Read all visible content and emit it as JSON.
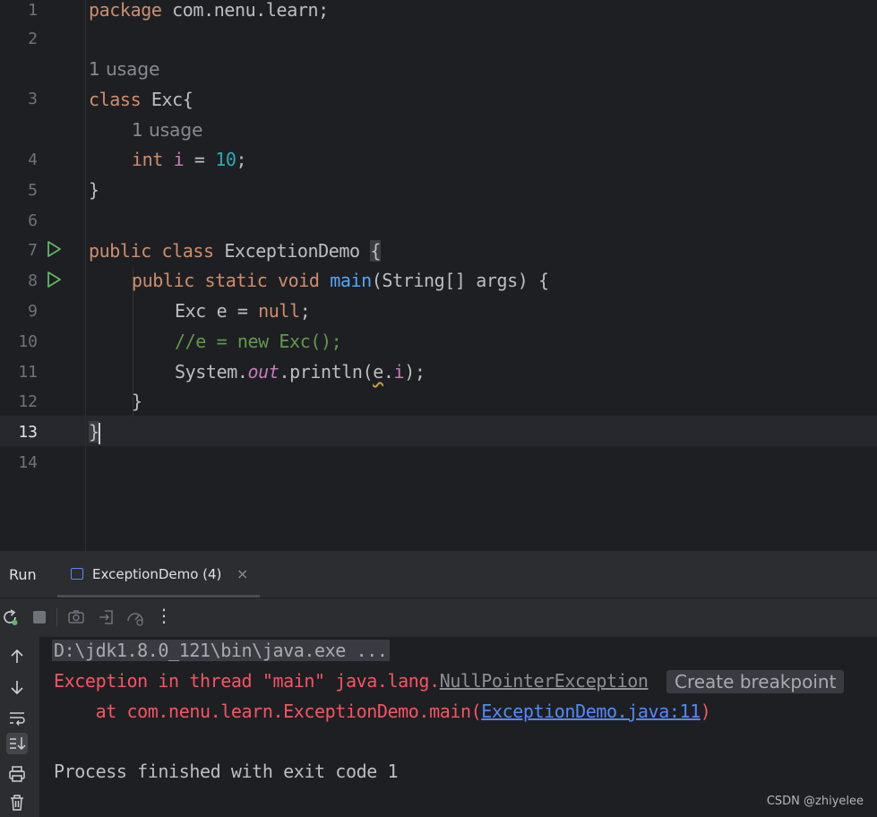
{
  "editor": {
    "line_numbers": [
      "1",
      "2",
      "3",
      "4",
      "5",
      "6",
      "7",
      "8",
      "9",
      "10",
      "11",
      "12",
      "13",
      "14"
    ],
    "current_line": "13",
    "hints": {
      "class_usage": "1 usage",
      "field_usage": "1 usage"
    },
    "code": {
      "l1_kw": "package",
      "l1_rest": " com.nenu.learn;",
      "l3_kw": "class",
      "l3_rest": " Exc{",
      "l4_kw": "int",
      "l4_field": "i",
      "l4_eq": " = ",
      "l4_num": "10",
      "l4_semi": ";",
      "l5": "}",
      "l7_kw": "public class",
      "l7_name": " ExceptionDemo ",
      "l7_brace": "{",
      "l8_kw": "public static void",
      "l8_fn": "main",
      "l8_rest": "(String[] args) {",
      "l9_text": "Exc e = ",
      "l9_kw": "null",
      "l9_semi": ";",
      "l10_comment": "//e = new Exc();",
      "l11_pre": "System.",
      "l11_out": "out",
      "l11_mid": ".println(",
      "l11_e": "e",
      "l11_dot": ".",
      "l11_i": "i",
      "l11_end": ");",
      "l12": "}",
      "l13": "}"
    }
  },
  "run_panel": {
    "label": "Run",
    "tab_label": "ExceptionDemo (4)",
    "tab_close": "×",
    "toolbar_icons": [
      "rerun-icon",
      "stop-icon",
      "camera-icon",
      "attach-icon",
      "profiler-icon",
      "more-icon"
    ],
    "more_glyph": "⋮",
    "side_icons": [
      "arrow-up-icon",
      "arrow-down-icon",
      "soft-wrap-icon",
      "scroll-to-end-icon",
      "print-icon",
      "trash-icon"
    ]
  },
  "console": {
    "command": "D:\\jdk1.8.0_121\\bin\\java.exe ...",
    "exc_prefix": "Exception in thread \"main\" java.lang.",
    "exc_class": "NullPointerException",
    "create_breakpoint": "Create breakpoint",
    "at_prefix": "    at com.nenu.learn.ExceptionDemo.main(",
    "at_link": "ExceptionDemo.java:11",
    "at_suffix": ")",
    "finished": "Process finished with exit code 1"
  },
  "watermark": "CSDN @zhiyelee",
  "colors": {
    "keyword": "#cf8e6d",
    "number": "#2aacb8",
    "field": "#c77dbb",
    "function": "#56a8f5",
    "comment": "#5f9a4c",
    "error": "#f75464",
    "link": "#548af7",
    "run_green": "#5fb865"
  }
}
